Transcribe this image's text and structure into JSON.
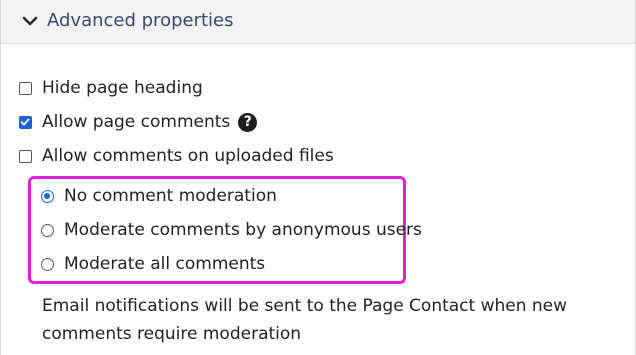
{
  "section": {
    "title": "Advanced properties",
    "toggle_icon": "chevron-down-icon"
  },
  "checkboxes": [
    {
      "label": "Hide page heading",
      "checked": false
    },
    {
      "label": "Allow page comments",
      "checked": true,
      "help_icon": "question-circle-icon",
      "help_glyph": "?"
    },
    {
      "label": "Allow comments on uploaded files",
      "checked": false
    }
  ],
  "moderation": {
    "options": [
      {
        "label": "No comment moderation",
        "selected": true
      },
      {
        "label": "Moderate comments by anonymous users",
        "selected": false
      },
      {
        "label": "Moderate all comments",
        "selected": false
      }
    ],
    "highlight_color": "#e020e0"
  },
  "note": "Email notifications will be sent to the Page Contact when new comments require moderation",
  "colors": {
    "accent": "#1a62d6",
    "header_text": "#3b4a6b",
    "header_bg": "#f3f3f3"
  }
}
